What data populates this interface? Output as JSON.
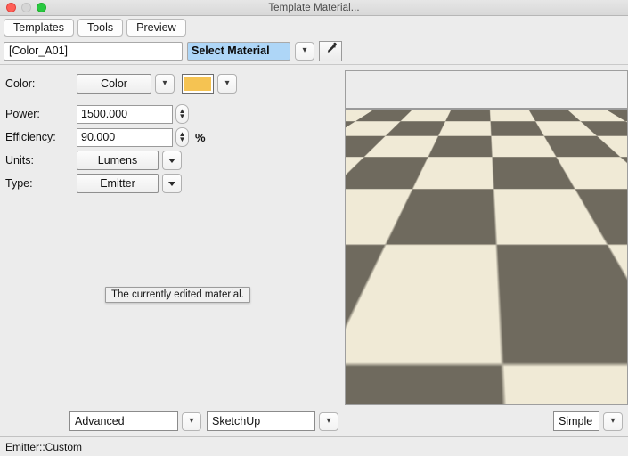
{
  "window": {
    "title": "Template Material...",
    "controls": [
      "close-button",
      "minimize-button",
      "zoom-button"
    ]
  },
  "toolbar": {
    "tabs": [
      {
        "label": "Templates",
        "name": "tab-templates"
      },
      {
        "label": "Tools",
        "name": "tab-tools"
      },
      {
        "label": "Preview",
        "name": "tab-preview"
      }
    ]
  },
  "select_row": {
    "material_name": "[Color_A01]",
    "material_name_placeholder": "Material name",
    "select_material": "Select Material",
    "caret_icon": "chevron-down-icon",
    "eyedropper_icon": "eyedropper-icon"
  },
  "form": {
    "color": {
      "label": "Color:",
      "value": "Color",
      "caret_icon": "chevron-down-icon",
      "swatch_color": "#f5c352",
      "swatch_caret_icon": "chevron-down-icon"
    },
    "power": {
      "label": "Power:",
      "value": "1500.000",
      "stepper_icon": "stepper-updown-icon"
    },
    "efficiency": {
      "label": "Efficiency:",
      "value": "90.000",
      "unit": "%",
      "stepper_icon": "stepper-updown-icon"
    },
    "units": {
      "label": "Units:",
      "value": "Lumens",
      "caret_icon": "triangle-down-icon"
    },
    "type": {
      "label": "Type:",
      "value": "Emitter",
      "caret_icon": "triangle-down-icon"
    }
  },
  "tooltip": {
    "text": "The currently edited material."
  },
  "preview": {
    "object_color": "#faf06a",
    "export_icon": "export-up-arrow-icon",
    "floor_light": "#f0ead6",
    "floor_dark": "#6f6a5e",
    "sky_color": "#ececec"
  },
  "footer": {
    "mode": {
      "value": "Advanced",
      "caret_icon": "chevron-down-icon"
    },
    "exporter": {
      "value": "SketchUp",
      "caret_icon": "chevron-down-icon"
    },
    "preview_mode": {
      "value": "Simple",
      "caret_icon": "chevron-down-icon"
    }
  },
  "status": {
    "text": "Emitter::Custom"
  }
}
